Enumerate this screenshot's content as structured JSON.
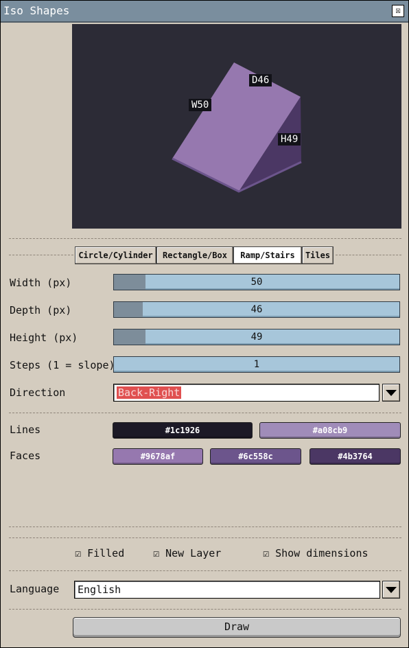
{
  "window": {
    "title": "Iso Shapes",
    "close_glyph": "☒",
    "close_icon": "close-icon"
  },
  "preview": {
    "shape_colors": {
      "top": "#9678af",
      "side": "#6c558c",
      "edge": "#4b3764"
    },
    "labels": {
      "width": "W50",
      "depth": "D46",
      "height": "H49"
    }
  },
  "tabs": [
    {
      "label": "Circle/Cylinder",
      "active": false
    },
    {
      "label": "Rectangle/Box",
      "active": false
    },
    {
      "label": "Ramp/Stairs",
      "active": true
    },
    {
      "label": "Tiles",
      "active": false
    }
  ],
  "fields": {
    "width": {
      "label": "Width (px)",
      "value": "50",
      "fraction": 0.11
    },
    "depth": {
      "label": "Depth (px)",
      "value": "46",
      "fraction": 0.1
    },
    "height": {
      "label": "Height (px)",
      "value": "49",
      "fraction": 0.11
    },
    "steps": {
      "label": "Steps (1 = slope)",
      "value": "1",
      "fraction": 0.0
    }
  },
  "direction": {
    "label": "Direction",
    "value": "Back-Right"
  },
  "lines": {
    "label": "Lines",
    "colors": [
      "#1c1926",
      "#a08cb9"
    ]
  },
  "faces": {
    "label": "Faces",
    "colors": [
      "#9678af",
      "#6c558c",
      "#4b3764"
    ]
  },
  "options": {
    "filled": {
      "label": "Filled",
      "checked": true
    },
    "new_layer": {
      "label": "New Layer",
      "checked": true
    },
    "show_dimensions": {
      "label": "Show dimensions",
      "checked": true
    },
    "check_glyph": "☑"
  },
  "language": {
    "label": "Language",
    "value": "English"
  },
  "draw": {
    "label": "Draw"
  }
}
